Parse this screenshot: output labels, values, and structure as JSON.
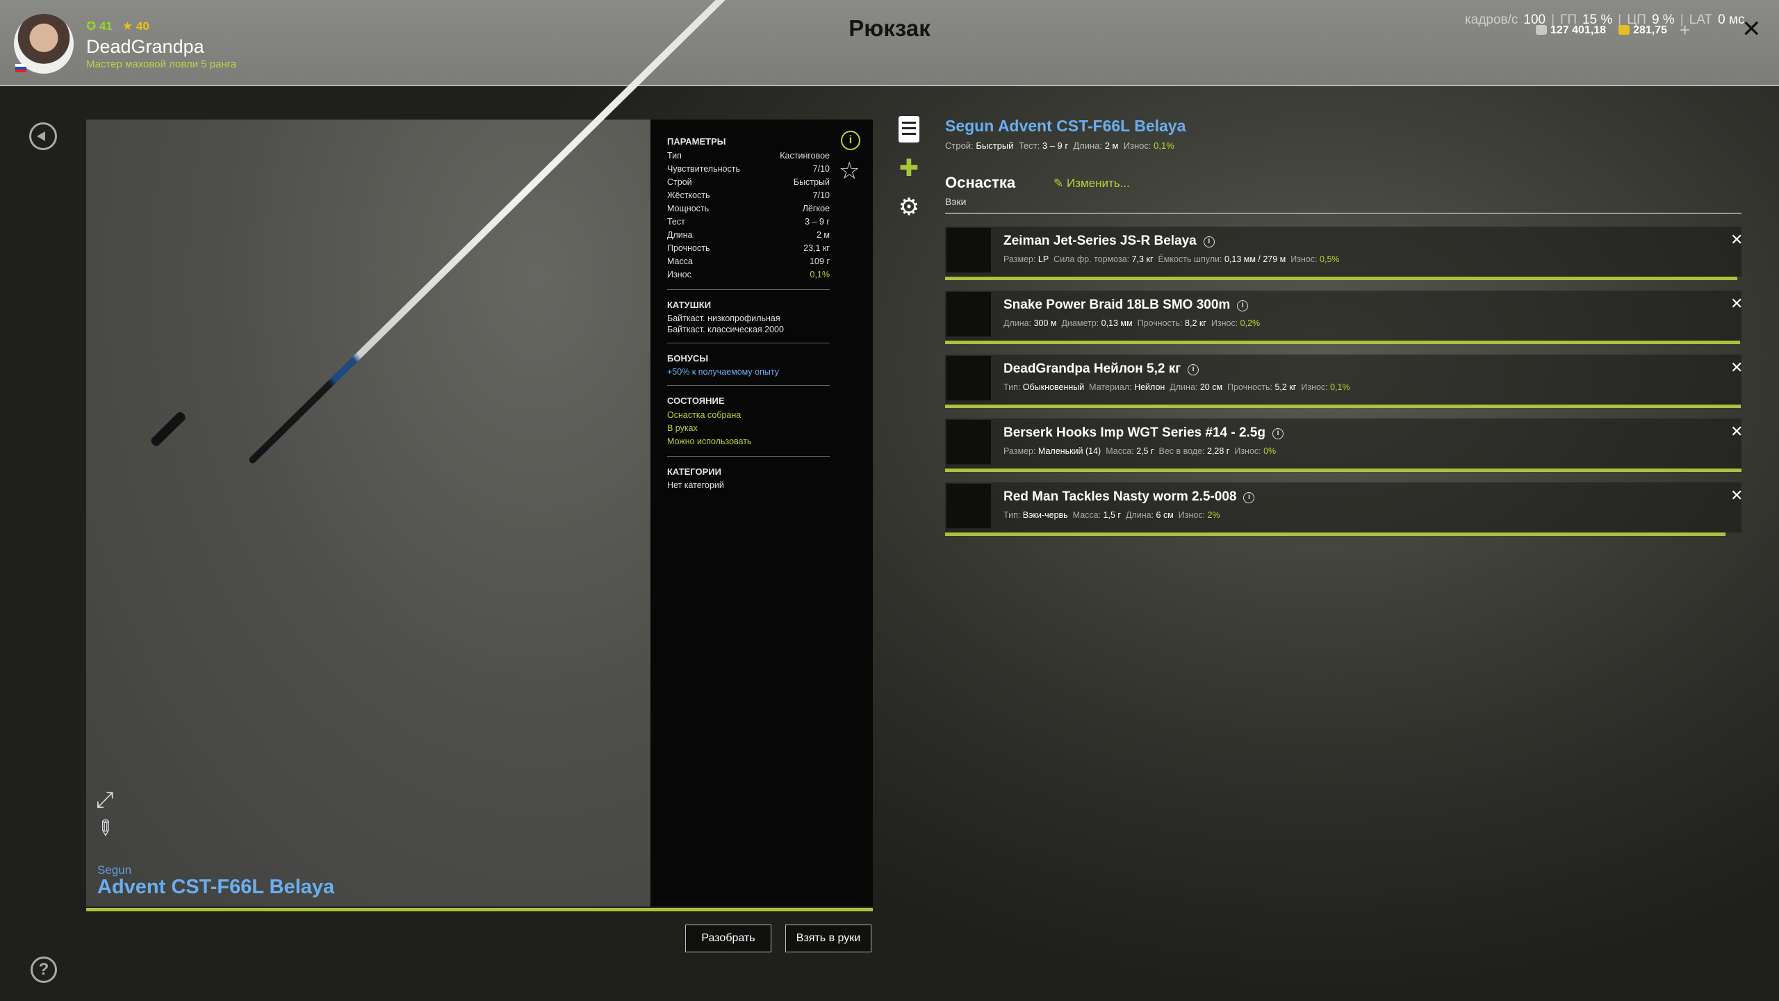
{
  "player": {
    "level_a": "41",
    "level_b": "40",
    "nick": "DeadGrandpa",
    "rank": "Мастер маховой ловли 5 ранга"
  },
  "page_title": "Рюкзак",
  "stats": {
    "fps_label": "кадров/с",
    "fps": "100",
    "gp_label": "ГП",
    "gp": "15 %",
    "cpu_label": "ЦП",
    "cpu": "9 %",
    "lat_label": "LAT",
    "lat": "0 мс"
  },
  "money": {
    "silver": "127 401,18",
    "gold": "281,75",
    "add": "+"
  },
  "rod": {
    "brand": "Segun",
    "name": "Advent CST-F66L Belaya",
    "full_name": "Segun Advent CST-F66L Belaya"
  },
  "params": {
    "title": "ПАРАМЕТРЫ",
    "rows": [
      {
        "k": "Тип",
        "v": "Кастинговое"
      },
      {
        "k": "Чувствительность",
        "v": "7/10"
      },
      {
        "k": "Строй",
        "v": "Быстрый"
      },
      {
        "k": "Жёсткость",
        "v": "7/10"
      },
      {
        "k": "Мощность",
        "v": "Лёгкое"
      },
      {
        "k": "Тест",
        "v": "3 – 9 г"
      },
      {
        "k": "Длина",
        "v": "2 м"
      },
      {
        "k": "Прочность",
        "v": "23,1 кг"
      },
      {
        "k": "Масса",
        "v": "109 г"
      },
      {
        "k": "Износ",
        "v": "0,1%"
      }
    ]
  },
  "reels": {
    "title": "КАТУШКИ",
    "items": [
      "Байткаст. низкопрофильная",
      "Байткаст. классическая 2000"
    ]
  },
  "bonuses": {
    "title": "БОНУСЫ",
    "items": [
      "+50% к получаемому опыту"
    ]
  },
  "state": {
    "title": "СОСТОЯНИЕ",
    "items": [
      "Оснастка собрана",
      "В руках",
      "Можно использовать"
    ]
  },
  "categories": {
    "title": "КАТЕГОРИИ",
    "value": "Нет категорий"
  },
  "rod_summary": {
    "l1": "Строй:",
    "v1": "Быстрый",
    "l2": "Тест:",
    "v2": "3 – 9 г",
    "l3": "Длина:",
    "v3": "2 м",
    "l4": "Износ:",
    "v4": "0,1%"
  },
  "rig": {
    "title": "Оснастка",
    "edit": "Изменить...",
    "type": "Вэки"
  },
  "slots": [
    {
      "name": "Zeiman Jet-Series JS-R Belaya",
      "wear": 0.995,
      "d": [
        [
          "Размер:",
          "LP"
        ],
        [
          "Сила фр. тормоза:",
          "7,3 кг"
        ],
        [
          "Ёмкость шпули:",
          "0,13 мм / 279 м"
        ]
      ],
      "w_label": "Износ:",
      "w": "0,5%"
    },
    {
      "name": "Snake Power Braid 18LB SMO 300m",
      "wear": 0.998,
      "d": [
        [
          "Длина:",
          "300 м"
        ],
        [
          "Диаметр:",
          "0,13 мм"
        ],
        [
          "Прочность:",
          "8,2 кг"
        ]
      ],
      "w_label": "Износ:",
      "w": "0,2%"
    },
    {
      "name": "DeadGrandpa Нейлон 5,2 кг",
      "wear": 0.999,
      "d": [
        [
          "Тип:",
          "Обыкновенный"
        ],
        [
          "Материал:",
          "Нейлон"
        ],
        [
          "Длина:",
          "20 см"
        ],
        [
          "Прочность:",
          "5,2 кг"
        ]
      ],
      "w_label": "Износ:",
      "w": "0,1%"
    },
    {
      "name": "Berserk Hooks Imp WGT Series #14 - 2.5g",
      "wear": 1.0,
      "d": [
        [
          "Размер:",
          "Маленький (14)"
        ],
        [
          "Масса:",
          "2,5 г"
        ],
        [
          "Вес в воде:",
          "2,28 г"
        ]
      ],
      "w_label": "Износ:",
      "w": "0%"
    },
    {
      "name": "Red Man Tackles Nasty worm 2.5-008",
      "wear": 0.98,
      "d": [
        [
          "Тип:",
          "Вэки-червь"
        ],
        [
          "Масса:",
          "1,5 г"
        ],
        [
          "Длина:",
          "6 см"
        ]
      ],
      "w_label": "Износ:",
      "w": "2%"
    }
  ],
  "buttons": {
    "disassemble": "Разобрать",
    "take": "Взять в руки"
  }
}
